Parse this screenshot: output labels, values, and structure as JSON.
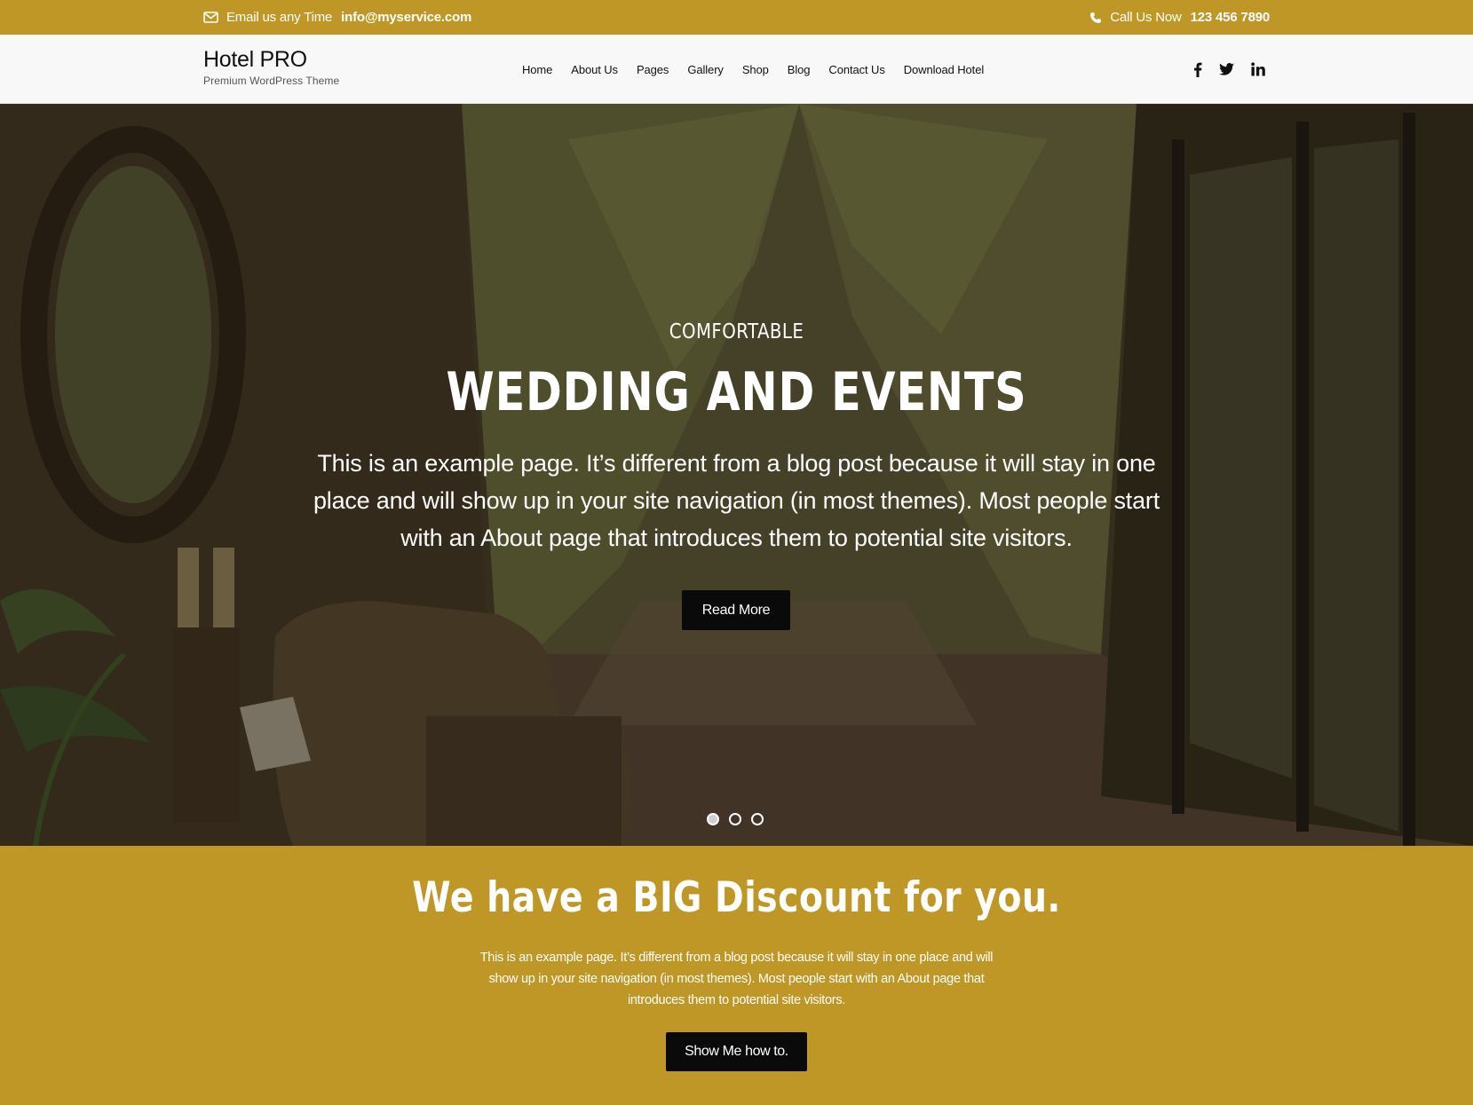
{
  "colors": {
    "accent": "#be9726",
    "button": "#0a0a0a",
    "header_bg": "#f8f8f8"
  },
  "topbar": {
    "email_icon": "envelope-icon",
    "email_label": "Email us any Time",
    "email_value": "info@myservice.com",
    "phone_icon": "phone-icon",
    "phone_label": "Call Us Now",
    "phone_value": "123 456 7890"
  },
  "header": {
    "title": "Hotel PRO",
    "tagline": "Premium WordPress Theme",
    "nav": [
      "Home",
      "About Us",
      "Pages",
      "Gallery",
      "Shop",
      "Blog",
      "Contact Us",
      "Download Hotel"
    ],
    "social": [
      "facebook-icon",
      "twitter-icon",
      "linkedin-icon"
    ]
  },
  "hero": {
    "subtitle": "COMFORTABLE",
    "title": "WEDDING AND EVENTS",
    "text": "This is an example page. It’s different from a blog post because it will stay in one place and will show up in your site navigation (in most themes). Most people start with an About page that introduces them to potential site visitors.",
    "button": "Read More",
    "slides": 3,
    "active_slide": 1
  },
  "discount": {
    "title": "We have a BIG Discount for you.",
    "text": "This is an example page. It’s different from a blog post because it will stay in one place and will show up in your site navigation (in most themes). Most people start with an About page that introduces them to potential site visitors.",
    "button": "Show Me how to."
  }
}
